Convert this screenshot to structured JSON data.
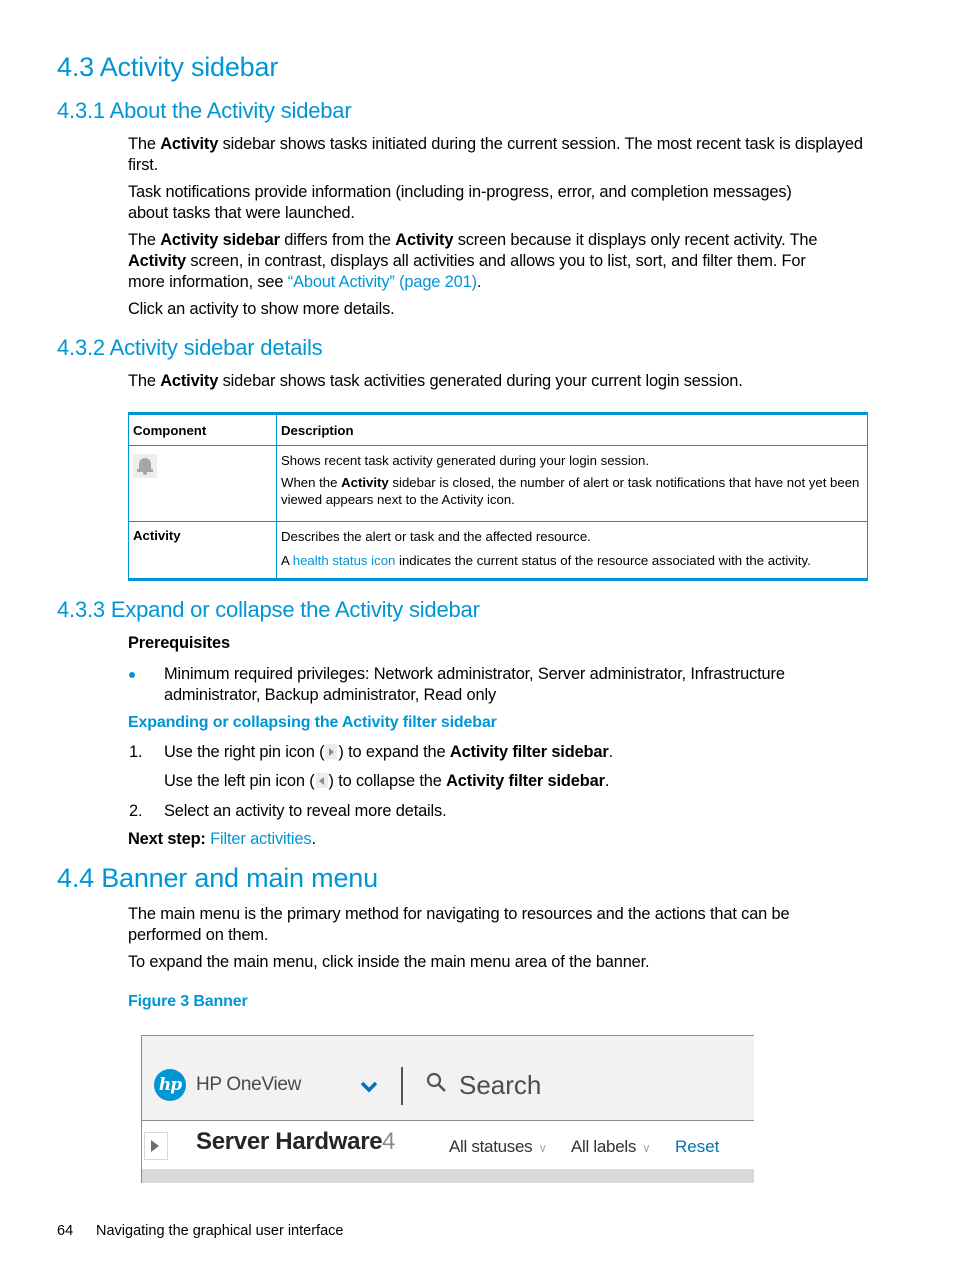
{
  "sections": {
    "s43": {
      "title": "4.3 Activity sidebar"
    },
    "s431": {
      "title": "4.3.1 About the Activity sidebar",
      "p1": {
        "pre": "The ",
        "bold": "Activity",
        "post": " sidebar shows tasks initiated during the current session. The most recent task is displayed",
        "line2": "first."
      },
      "p2": {
        "line1": "Task notifications provide information (including in-progress, error, and completion messages)",
        "line2": "about tasks that were launched."
      },
      "p3": {
        "t1": "The ",
        "b1": "Activity sidebar",
        "t2": " differs from the ",
        "b2": "Activity",
        "t3": " screen because it displays only recent activity. The",
        "b3": "Activity",
        "t4": " screen, in contrast, displays all activities and allows you to list, sort, and filter them. For",
        "t5": "more information, see ",
        "link": "“About Activity” (page 201)",
        "t6": "."
      },
      "p4": "Click an activity to show more details."
    },
    "s432": {
      "title": "4.3.2 Activity sidebar details",
      "p1": {
        "pre": "The ",
        "bold": "Activity",
        "post": " sidebar shows task activities generated during your current login session."
      },
      "table": {
        "headers": [
          "Component",
          "Description"
        ],
        "rows": [
          {
            "component_icon": "bell-icon",
            "d1": "Shows recent task activity generated during your login session.",
            "d2_pre": "When the ",
            "d2_bold": "Activity",
            "d2_post": " sidebar is closed, the number of alert or task notifications that have not yet been viewed appears next to the Activity icon."
          },
          {
            "component": "Activity",
            "d1": "Describes the alert or task and the affected resource.",
            "d2_pre": "A ",
            "d2_link": "health status icon",
            "d2_post": " indicates the current status of the resource associated with the activity."
          }
        ]
      }
    },
    "s433": {
      "title": "4.3.3 Expand or collapse the Activity sidebar",
      "prereq_label": "Prerequisites",
      "bullet": {
        "line1": "Minimum required privileges: Network administrator, Server administrator, Infrastructure",
        "line2": "administrator, Backup administrator, Read only"
      },
      "proc_title": "Expanding or collapsing the Activity filter sidebar",
      "steps": [
        {
          "num": "1.",
          "a": "Use the right pin icon (",
          "b": ") to expand the ",
          "bold": "Activity filter sidebar",
          "c": ".",
          "sub_a": "Use the left pin icon (",
          "sub_b": ") to collapse the ",
          "sub_bold": "Activity filter sidebar",
          "sub_c": "."
        },
        {
          "num": "2.",
          "text": "Select an activity to reveal more details."
        }
      ],
      "next_label": "Next step:",
      "next_link": "Filter activities",
      "next_end": "."
    },
    "s44": {
      "title": "4.4 Banner and main menu",
      "p1": {
        "line1": "The main menu is the primary method for navigating to resources and the actions that can be",
        "line2": "performed on them."
      },
      "p2": "To expand the main menu, click inside the main menu area of the banner.",
      "figure_caption": "Figure 3 Banner"
    }
  },
  "banner": {
    "logo_text": "hp",
    "app_name": "HP OneView",
    "search_placeholder": "Search",
    "page_title": "Server Hardware",
    "count": "4",
    "filter_status": "All statuses",
    "filter_labels": "All labels",
    "dropdown_glyph": "∨",
    "reset": "Reset"
  },
  "footer": {
    "page_number": "64",
    "section": "Navigating the graphical user interface"
  },
  "colors": {
    "accent": "#0096d6",
    "banner_bg": "#f2f2f2",
    "reset_link": "#0073b7"
  }
}
